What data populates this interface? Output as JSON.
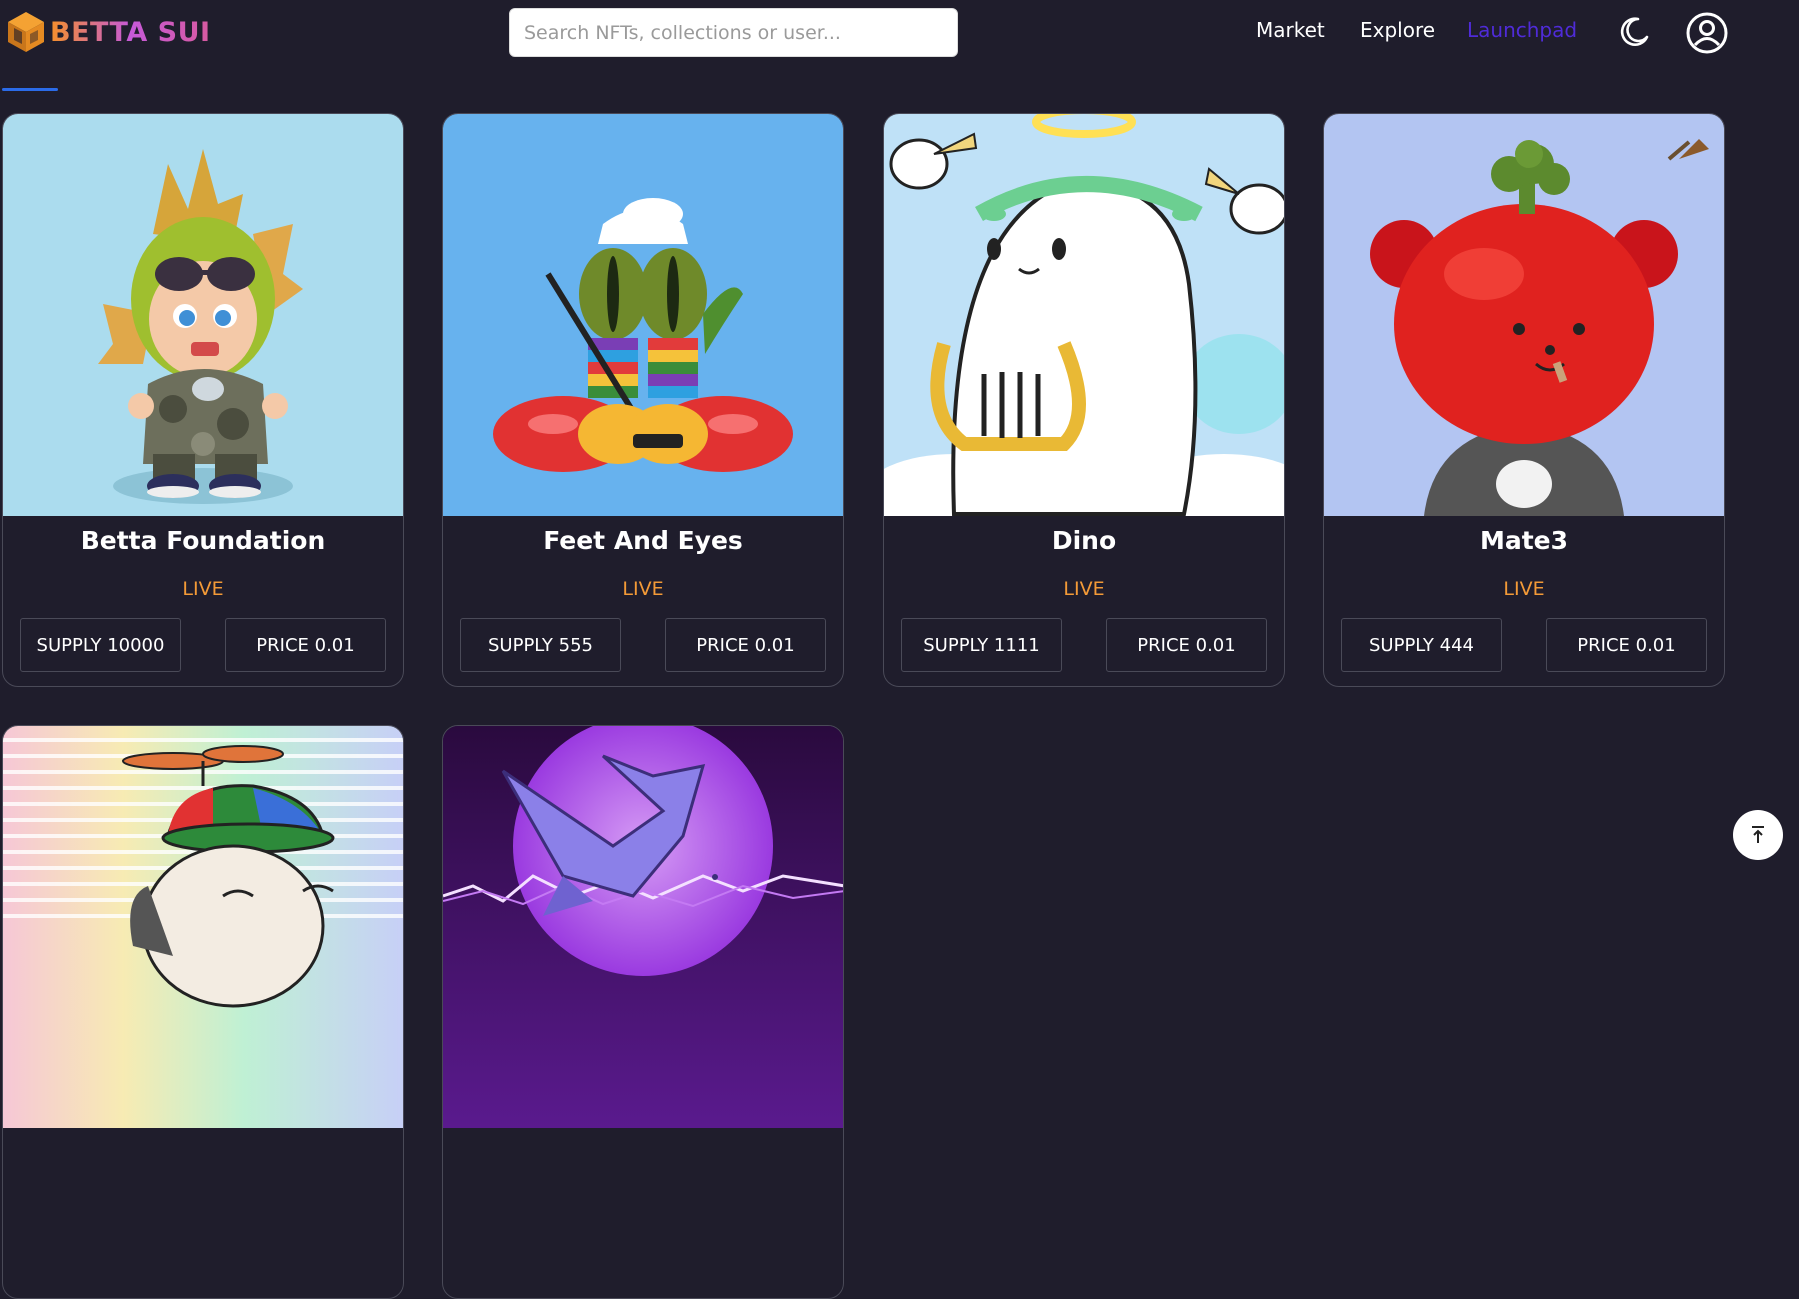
{
  "brand": {
    "name": "BETTA SUI"
  },
  "search": {
    "placeholder": "Search NFTs, collections or user..."
  },
  "nav": [
    {
      "label": "Market",
      "active": false
    },
    {
      "label": "Explore",
      "active": false
    },
    {
      "label": "Launchpad",
      "active": true
    }
  ],
  "icons": {
    "theme": "moon-icon",
    "profile": "user-circle-icon",
    "scroll_top": "arrow-up-to-line-icon"
  },
  "colors": {
    "background": "#1f1d2c",
    "accent": "#4f2bd8",
    "live": "#f39a37",
    "tab_underline": "#2b6be8"
  },
  "collections": [
    {
      "name": "Betta Foundation",
      "status": "LIVE",
      "supply": "SUPPLY 10000",
      "price": "PRICE 0.01"
    },
    {
      "name": "Feet And Eyes",
      "status": "LIVE",
      "supply": "SUPPLY 555",
      "price": "PRICE 0.01"
    },
    {
      "name": "Dino",
      "status": "LIVE",
      "supply": "SUPPLY 1111",
      "price": "PRICE 0.01"
    },
    {
      "name": "Mate3",
      "status": "LIVE",
      "supply": "SUPPLY 444",
      "price": "PRICE 0.01"
    },
    {
      "name": "",
      "status": "",
      "supply": "",
      "price": ""
    },
    {
      "name": "",
      "status": "",
      "supply": "",
      "price": ""
    }
  ]
}
